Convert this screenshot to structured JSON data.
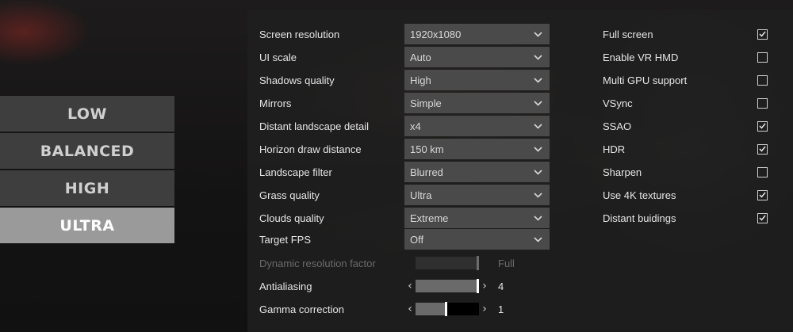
{
  "colors": {
    "preset_bg": "#3e3e3e",
    "preset_active_bg": "#9a9a9a",
    "panel_bg": "#202020",
    "select_bg": "#4a4a4a"
  },
  "presets": [
    {
      "label": "LOW",
      "active": false
    },
    {
      "label": "BALANCED",
      "active": false
    },
    {
      "label": "HIGH",
      "active": false
    },
    {
      "label": "ULTRA",
      "active": true
    }
  ],
  "settings": [
    {
      "label": "Screen resolution",
      "value": "1920x1080",
      "icon": "chevron-down-icon"
    },
    {
      "label": "UI scale",
      "value": "Auto",
      "icon": "chevron-down-icon"
    },
    {
      "label": "Shadows quality",
      "value": "High",
      "icon": "chevron-down-icon"
    },
    {
      "label": "Mirrors",
      "value": "Simple",
      "icon": "chevron-down-icon"
    },
    {
      "label": "Distant landscape detail",
      "value": "x4",
      "icon": "chevron-down-icon"
    },
    {
      "label": "Horizon draw distance",
      "value": "150 km",
      "icon": "chevron-down-icon"
    },
    {
      "label": "Landscape filter",
      "value": "Blurred",
      "icon": "chevron-down-icon"
    },
    {
      "label": "Grass quality",
      "value": "Ultra",
      "icon": "chevron-down-icon"
    },
    {
      "label": "Clouds quality",
      "value": "Extreme",
      "icon": "chevron-down-icon"
    },
    {
      "label": "Target FPS",
      "value": "Off",
      "icon": "chevron-down-icon"
    }
  ],
  "sliders": {
    "dynamic_resolution": {
      "label": "Dynamic resolution factor",
      "value": "Full",
      "level": 1.0,
      "enabled": false
    },
    "antialiasing": {
      "label": "Antialiasing",
      "value": "4",
      "level": 1.0,
      "enabled": true
    },
    "gamma": {
      "label": "Gamma correction",
      "value": "1",
      "level": 0.48,
      "enabled": true
    }
  },
  "checkboxes": [
    {
      "label": "Full screen",
      "checked": true
    },
    {
      "label": "Enable VR HMD",
      "checked": false
    },
    {
      "label": "Multi GPU support",
      "checked": false
    },
    {
      "label": "VSync",
      "checked": false
    },
    {
      "label": "SSAO",
      "checked": true
    },
    {
      "label": "HDR",
      "checked": true
    },
    {
      "label": "Sharpen",
      "checked": false
    },
    {
      "label": "Use 4K textures",
      "checked": true
    },
    {
      "label": "Distant buidings",
      "checked": true
    }
  ]
}
